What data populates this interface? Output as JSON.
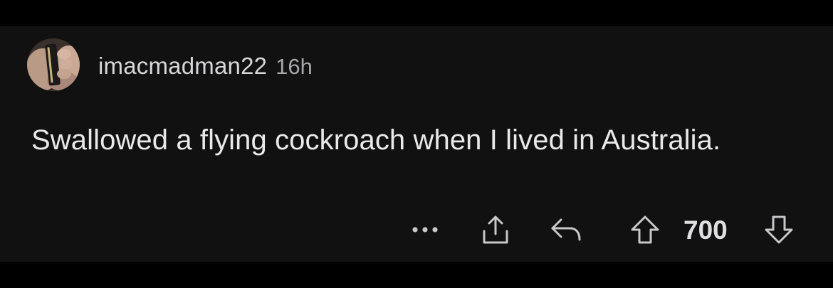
{
  "comment": {
    "username": "imacmadman22",
    "timestamp": "16h",
    "body": "Swallowed a flying cockroach when I lived in Australia.",
    "avatar": "user-avatar-photo"
  },
  "actions": {
    "more_icon": "more-horizontal-icon",
    "share_icon": "share-icon",
    "reply_icon": "reply-icon",
    "upvote_icon": "upvote-arrow-icon",
    "vote_count": "700",
    "downvote_icon": "downvote-arrow-icon"
  },
  "colors": {
    "background": "#111112",
    "frame": "#000000",
    "text_primary": "#e9e9ea",
    "text_secondary": "#a8a8ab",
    "icon": "#c8c8cb"
  }
}
